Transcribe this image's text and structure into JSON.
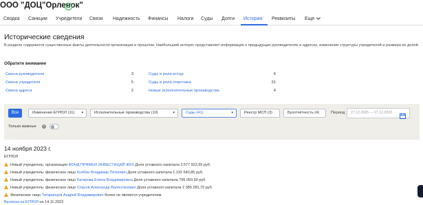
{
  "company": {
    "title": "ООО \"ДОЦ\"Орленок\""
  },
  "tabs": [
    {
      "label": "Сводка"
    },
    {
      "label": "Санкции"
    },
    {
      "label": "Учредители"
    },
    {
      "label": "Связи"
    },
    {
      "label": "Надежность"
    },
    {
      "label": "Финансы"
    },
    {
      "label": "Налоги"
    },
    {
      "label": "Суды"
    },
    {
      "label": "Долги"
    },
    {
      "label": "История"
    },
    {
      "label": "Реквизиты"
    },
    {
      "label": "Еще"
    }
  ],
  "active_tab": "История",
  "section": {
    "title": "Исторические сведения",
    "description": "В разделе содержатся существенные факты деятельности организации в прошлом. Наибольший интерес представляет информация о предыдущих руководителях и адресах, изменении структуры учредителей и размера их долей."
  },
  "attention": {
    "title": "Обратите внимание",
    "left": [
      {
        "label": "Смена руководителя",
        "count": "3"
      },
      {
        "label": "Смена учредителя",
        "count": "5"
      },
      {
        "label": "Смена адреса",
        "count": "2"
      }
    ],
    "right": [
      {
        "label": "Суды в роли истца",
        "count": "6"
      },
      {
        "label": "Суды в роли ответчика",
        "count": "31"
      },
      {
        "label": "Новые исполнительные производства",
        "count": "4"
      }
    ]
  },
  "filters": {
    "all_label": "Все",
    "chips": [
      {
        "label": "Изменения ЕГРЮЛ (11)"
      },
      {
        "label": "Исполнительные производства (10)"
      },
      {
        "label": "Суды (41)"
      },
      {
        "label": "Реестр МСП (3)"
      },
      {
        "label": "Бухотчётность (4)"
      }
    ],
    "period_label": "Период",
    "period_value": "27.12.2005 — 27.12.2023",
    "only_important_label": "Только важные",
    "only_important_on": false,
    "info_glyph": "?"
  },
  "events": {
    "date": "14 ноября 2023 г.",
    "group": "ЕГРЮЛ",
    "rows": [
      {
        "prefix": "Новый учредитель: организация ",
        "name": "ФОНД ПРЯМЫХ ИНВЕСТИЦИЙ ЖКХ",
        "suffix": " Доля уставного капитала 3 577 922,55 руб."
      },
      {
        "prefix": "Новый учредитель: физическое лицо ",
        "name": "Колбин Владимир Петрович",
        "suffix": " Доля уставного капитала 1 192 640,85 руб."
      },
      {
        "prefix": "Новый учредитель: физическое лицо ",
        "name": "Багирова Елена Владимировна",
        "suffix": " Доля уставного капитала 795 093,90 руб."
      },
      {
        "prefix": "Новый учредитель: физическое лицо ",
        "name": "Спасов Александр Валентинович",
        "suffix": " Доля уставного капитала 2 385 281,70 руб."
      },
      {
        "prefix": "Физическое лицо ",
        "name": "Татаринцев Андрей Владимирович",
        "suffix": " более не является учредителем"
      }
    ],
    "extract_link": "Выписка из ЕГРЮЛ",
    "extract_suffix": " на 14.11.2023"
  },
  "colors": {
    "accent": "#2d6cdf",
    "warning": "#f0a01e",
    "verified": "#36a852",
    "panel": "#f0eee8"
  }
}
